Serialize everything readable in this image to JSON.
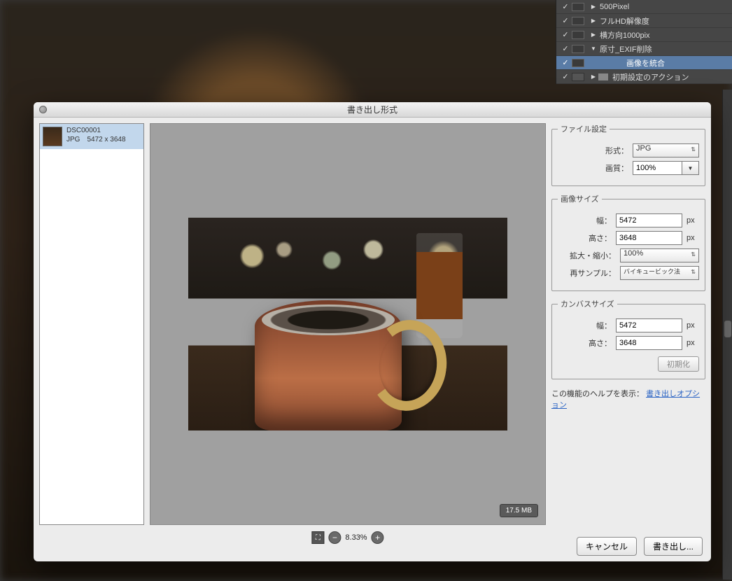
{
  "actions": {
    "items": [
      {
        "label": "500Pixel",
        "expand": "▶"
      },
      {
        "label": "フルHD解像度",
        "expand": "▶"
      },
      {
        "label": "横方向1000pix",
        "expand": "▶"
      },
      {
        "label": "原寸_EXIF削除",
        "expand": "▼"
      },
      {
        "label": "画像を統合",
        "selected": true,
        "indent": 2
      },
      {
        "label": "初期設定のアクション",
        "expand": "▶",
        "folder": true
      }
    ]
  },
  "dialog": {
    "title": "書き出し形式",
    "file": {
      "name": "DSC00001",
      "ext": "JPG",
      "dims": "5472 x 3648"
    },
    "size_badge": "17.5 MB",
    "zoom": {
      "level": "8.33%"
    },
    "file_settings": {
      "legend": "ファイル設定",
      "format_label": "形式：",
      "format_value": "JPG",
      "quality_label": "画質：",
      "quality_value": "100%"
    },
    "image_size": {
      "legend": "画像サイズ",
      "width_label": "幅：",
      "width_value": "5472",
      "height_label": "高さ：",
      "height_value": "3648",
      "unit": "px",
      "scale_label": "拡大・縮小：",
      "scale_value": "100%",
      "resample_label": "再サンプル：",
      "resample_value": "バイキュービック法"
    },
    "canvas_size": {
      "legend": "カンバスサイズ",
      "width_label": "幅：",
      "width_value": "5472",
      "height_label": "高さ：",
      "height_value": "3648",
      "unit": "px",
      "reset": "初期化"
    },
    "help": {
      "prefix": "この機能のヘルプを表示：",
      "link": "書き出しオプション"
    },
    "buttons": {
      "cancel": "キャンセル",
      "export": "書き出し..."
    }
  }
}
